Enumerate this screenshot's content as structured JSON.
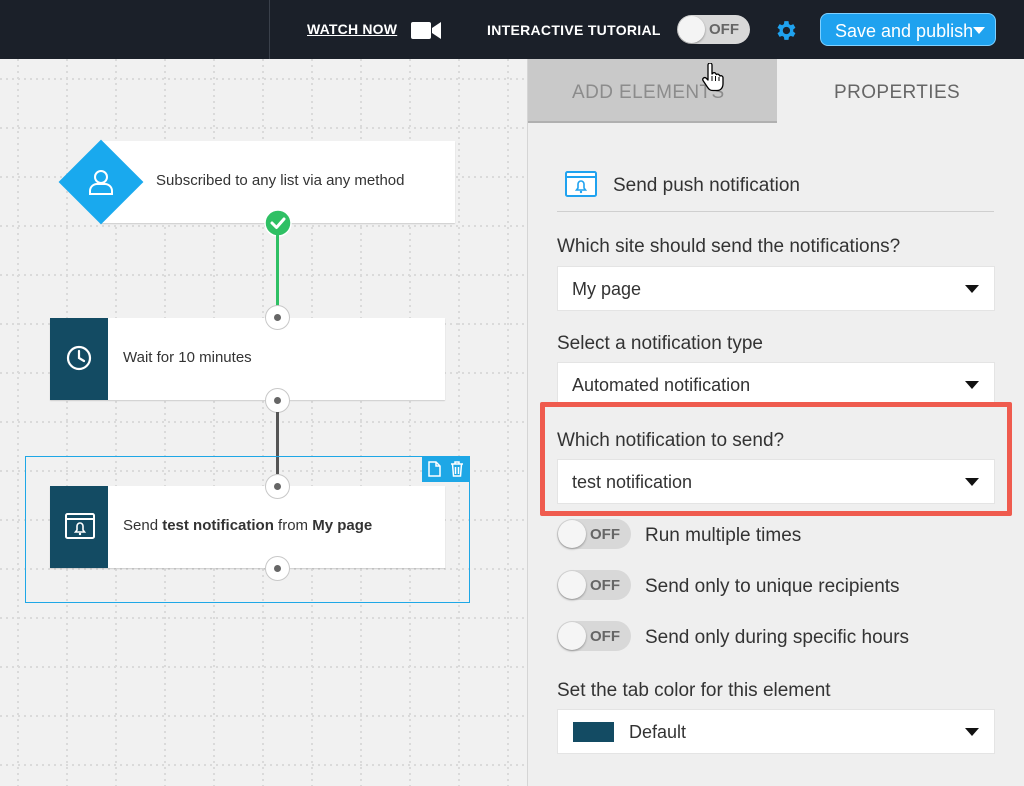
{
  "topbar": {
    "watch_label": "WATCH NOW",
    "tutorial_label": "INTERACTIVE TUTORIAL",
    "tutorial_toggle": "OFF",
    "save_label": "Save and publish"
  },
  "canvas": {
    "trigger_text": "Subscribed to any list via any method",
    "wait_text": "Wait for 10 minutes",
    "send_prefix": "Send ",
    "send_bold1": "test notification",
    "send_mid": " from ",
    "send_bold2": "My page"
  },
  "panel": {
    "tabs": [
      "ADD ELEMENTS",
      "PROPERTIES"
    ],
    "element_title": "Send push notification",
    "fields": [
      {
        "label": "Which site should send the notifications?",
        "value": "My page"
      },
      {
        "label": "Select a notification type",
        "value": "Automated notification"
      },
      {
        "label": "Which notification to send?",
        "value": "test notification"
      }
    ],
    "toggles": [
      {
        "state": "OFF",
        "label": "Run multiple times"
      },
      {
        "state": "OFF",
        "label": "Send only to unique recipients"
      },
      {
        "state": "OFF",
        "label": "Send only during specific hours"
      }
    ],
    "color_label": "Set the tab color for this element",
    "color_value": "Default"
  },
  "colors": {
    "accent": "#1fa2ef",
    "node_dark": "#134b63",
    "highlight": "#ef5b4e",
    "success": "#2fc064"
  },
  "icons": [
    "video-camera-icon",
    "gear-icon",
    "hand-cursor-icon",
    "user-icon",
    "check-icon",
    "clock-icon",
    "push-notification-icon",
    "copy-icon",
    "trash-icon"
  ]
}
